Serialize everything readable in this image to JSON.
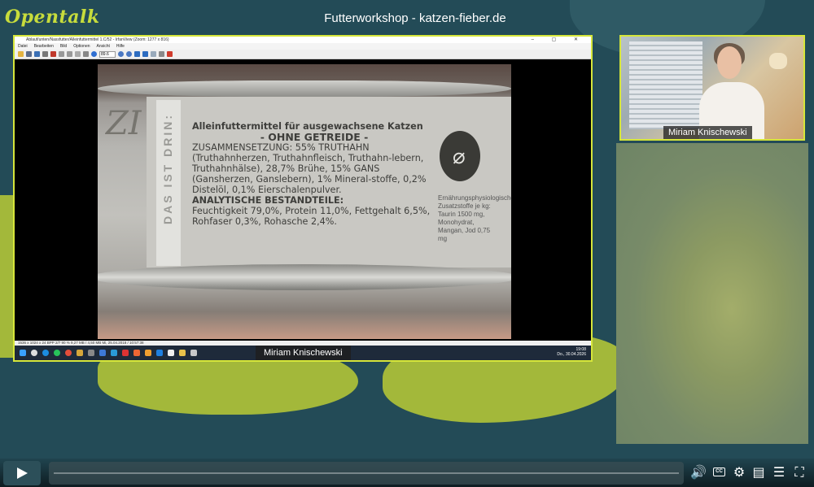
{
  "app": {
    "logo_text": "Opentalk",
    "title": "Futterworkshop - katzen-fieber.de"
  },
  "screenshare": {
    "window_title": "Ablauf/unten/Nassfutter/Alleinfuttermittel 1.C/52 - IrfanView (Zoom: 1277 x 816)",
    "window_controls": "– ▢ ✕",
    "menu": [
      "Datei",
      "Bearbeiten",
      "Bild",
      "Optionen",
      "Ansicht",
      "Hilfe"
    ],
    "zoom_value": "89.6",
    "status_text": "1536 x 1024 x 24 BPP   2/7   90 %   9,27 MB / 4,50 MB   Mi, 25.04.2018 / 10:57:38",
    "can": {
      "side_band": "DAS IST DRIN:",
      "heading": "Alleinfuttermittel für ausgewachsene Katzen",
      "no_grain": "- OHNE GETREIDE -",
      "composition": "ZUSAMMENSETZUNG: 55% TRUTHAHN (Truthahnherzen, Truthahnfleisch, Truthahn-lebern, Truthahnhälse), 28,7% Brühe, 15% GANS (Gansherzen, Ganslebern), 1% Mineral-stoffe, 0,2% Distelöl, 0,1% Eierschalenpulver.",
      "analysis_title": "ANALYTISCHE BESTANDTEILE:",
      "analysis": "Feuchtigkeit 79,0%, Protein 11,0%, Fettgehalt 6,5%, Rohfaser 0,3%, Rohasche 2,4%.",
      "side_text": "Ernährungsphysiologische Zusatzstoffe je kg: Taurin 1500 mg, Monohydrat, Mangan, Jod 0,75 mg"
    },
    "presenter_name": "Miriam Knischewski",
    "clock_time": "19:08",
    "clock_date": "Do., 30.04.2026"
  },
  "camera": {
    "participant_name": "Miriam Knischewski"
  },
  "player": {
    "play_icon": "play-icon",
    "cc_label": "CC"
  }
}
